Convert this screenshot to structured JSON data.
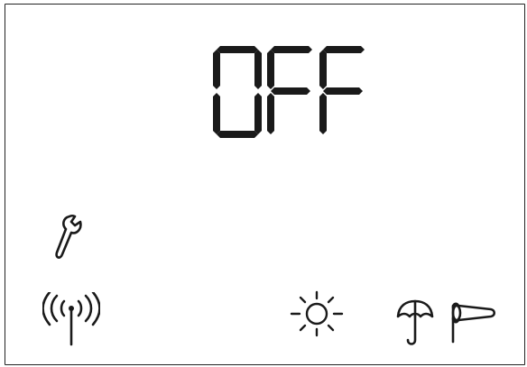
{
  "display": {
    "status_text": "OFF"
  },
  "indicators": {
    "service": {
      "icon": "wrench-icon"
    },
    "connectivity": {
      "icon": "wireless-signal-icon"
    },
    "weather_sun": {
      "icon": "sun-icon"
    },
    "weather_rain": {
      "icon": "umbrella-icon"
    },
    "weather_wind": {
      "icon": "windsock-icon"
    }
  },
  "colors": {
    "segment": "#1a1a1a",
    "background": "#ffffff",
    "border": "#222222"
  }
}
